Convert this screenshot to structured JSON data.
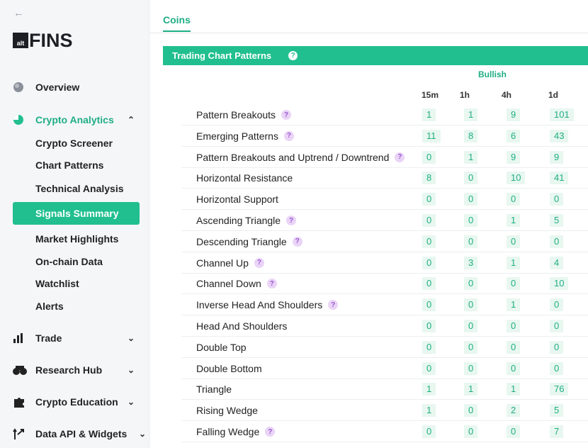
{
  "sidebar": {
    "back_icon": "arrow-left-icon",
    "logo": {
      "badge": "alt",
      "word": "FINS"
    },
    "overview": "Overview",
    "crypto_analytics": "Crypto Analytics",
    "crypto_analytics_items": [
      "Crypto Screener",
      "Chart Patterns",
      "Technical Analysis",
      "Signals Summary",
      "Market Highlights",
      "On-chain Data",
      "Watchlist",
      "Alerts"
    ],
    "active_item": "Signals Summary",
    "trade": "Trade",
    "research_hub": "Research Hub",
    "crypto_education": "Crypto Education",
    "data_api": "Data API & Widgets"
  },
  "tabs": {
    "coins": "Coins"
  },
  "section": {
    "title": "Trading Chart Patterns",
    "help": "?"
  },
  "table": {
    "group": "Bullish",
    "columns": [
      "15m",
      "1h",
      "4h",
      "1d"
    ],
    "rows": [
      {
        "label": "Pattern Breakouts",
        "help": true,
        "values": [
          "1",
          "1",
          "9",
          "101"
        ]
      },
      {
        "label": "Emerging Patterns",
        "help": true,
        "values": [
          "11",
          "8",
          "6",
          "43"
        ]
      },
      {
        "label": "Pattern Breakouts and Uptrend / Downtrend",
        "help": true,
        "values": [
          "0",
          "1",
          "9",
          "9"
        ]
      },
      {
        "label": "Horizontal Resistance",
        "help": false,
        "values": [
          "8",
          "0",
          "10",
          "41"
        ]
      },
      {
        "label": "Horizontal Support",
        "help": false,
        "values": [
          "0",
          "0",
          "0",
          "0"
        ]
      },
      {
        "label": "Ascending Triangle",
        "help": true,
        "values": [
          "0",
          "0",
          "1",
          "5"
        ]
      },
      {
        "label": "Descending Triangle",
        "help": true,
        "values": [
          "0",
          "0",
          "0",
          "0"
        ]
      },
      {
        "label": "Channel Up",
        "help": true,
        "values": [
          "0",
          "3",
          "1",
          "4"
        ]
      },
      {
        "label": "Channel Down",
        "help": true,
        "values": [
          "0",
          "0",
          "0",
          "10"
        ]
      },
      {
        "label": "Inverse Head And Shoulders",
        "help": true,
        "values": [
          "0",
          "0",
          "1",
          "0"
        ]
      },
      {
        "label": "Head And Shoulders",
        "help": false,
        "values": [
          "0",
          "0",
          "0",
          "0"
        ]
      },
      {
        "label": "Double Top",
        "help": false,
        "values": [
          "0",
          "0",
          "0",
          "0"
        ]
      },
      {
        "label": "Double Bottom",
        "help": false,
        "values": [
          "0",
          "0",
          "0",
          "0"
        ]
      },
      {
        "label": "Triangle",
        "help": false,
        "values": [
          "1",
          "1",
          "1",
          "76"
        ]
      },
      {
        "label": "Rising Wedge",
        "help": false,
        "values": [
          "1",
          "0",
          "2",
          "5"
        ]
      },
      {
        "label": "Falling Wedge",
        "help": true,
        "values": [
          "0",
          "0",
          "0",
          "7"
        ]
      }
    ]
  },
  "colors": {
    "accent": "#21bf8f",
    "accent_text": "#1fae84",
    "cell_bg": "#e8f7f0",
    "help_bg": "#ead4f7"
  }
}
